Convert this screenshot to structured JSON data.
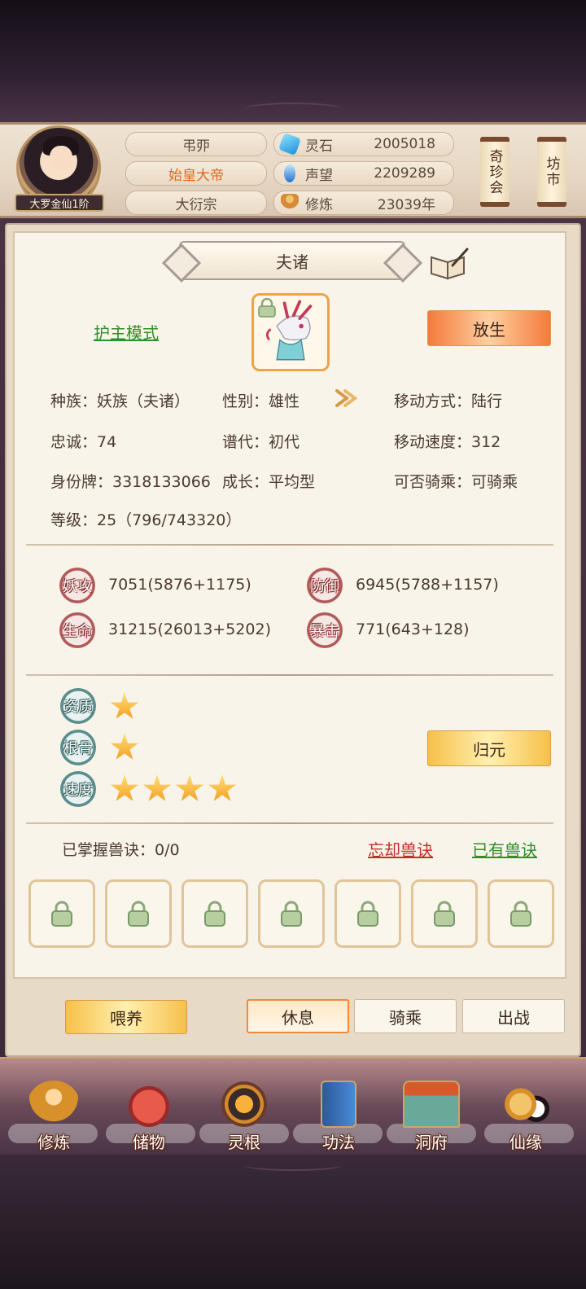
{
  "header": {
    "player_name": "弔丣",
    "title": "始皇大帝",
    "sect": "大衍宗",
    "rank_badge": "大罗金仙1阶",
    "resources": [
      {
        "label": "灵石",
        "value": "2005018",
        "icon": "spirit-stone-icon"
      },
      {
        "label": "声望",
        "value": "2209289",
        "icon": "prestige-crystal-icon"
      },
      {
        "label": "修炼",
        "value": "23039年",
        "icon": "meditation-icon"
      }
    ],
    "right_buttons": [
      "奇珍会",
      "坊市"
    ]
  },
  "pet": {
    "name": "夫诸",
    "mode_link": "护主模式",
    "release_button": "放生",
    "info": {
      "race": "种族：妖族（夫诸）",
      "gender": "性别：雄性",
      "move_type": "移动方式：陆行",
      "loyalty": "忠诚：74",
      "lineage": "谱代：初代",
      "move_speed": "移动速度：312",
      "id_tag": "身份牌：3318133066",
      "growth": "成长：平均型",
      "rideable": "可否骑乘：可骑乘",
      "level": "等级：25（796/743320）"
    },
    "stats": [
      {
        "label": "妖攻",
        "value": "7051(5876+1175)"
      },
      {
        "label": "防御",
        "value": "6945(5788+1157)"
      },
      {
        "label": "生命",
        "value": "31215(26013+5202)"
      },
      {
        "label": "暴击",
        "value": "771(643+128)"
      }
    ],
    "ratings": [
      {
        "label": "资质",
        "stars": 1
      },
      {
        "label": "根骨",
        "stars": 1
      },
      {
        "label": "速度",
        "stars": 4
      }
    ],
    "return_button": "归元",
    "skills": {
      "mastered": "已掌握兽诀：0/0",
      "forget_link": "忘却兽诀",
      "owned_link": "已有兽诀",
      "slot_count": 7
    }
  },
  "actions": {
    "feed": "喂养",
    "tabs": [
      "休息",
      "骑乘",
      "出战"
    ],
    "active_tab": "休息"
  },
  "nav": [
    {
      "label": "修炼",
      "icon": "cultivate-icon"
    },
    {
      "label": "储物",
      "icon": "storage-bag-icon"
    },
    {
      "label": "灵根",
      "icon": "spirit-root-icon"
    },
    {
      "label": "功法",
      "icon": "technique-book-icon"
    },
    {
      "label": "洞府",
      "icon": "cave-mansion-icon"
    },
    {
      "label": "仙缘",
      "icon": "immortal-fate-icon"
    }
  ],
  "colors": {
    "accent_orange": "#f37a3c",
    "link_green": "#2f8f2a",
    "link_red": "#c0302a",
    "title_orange": "#e06a1a"
  }
}
